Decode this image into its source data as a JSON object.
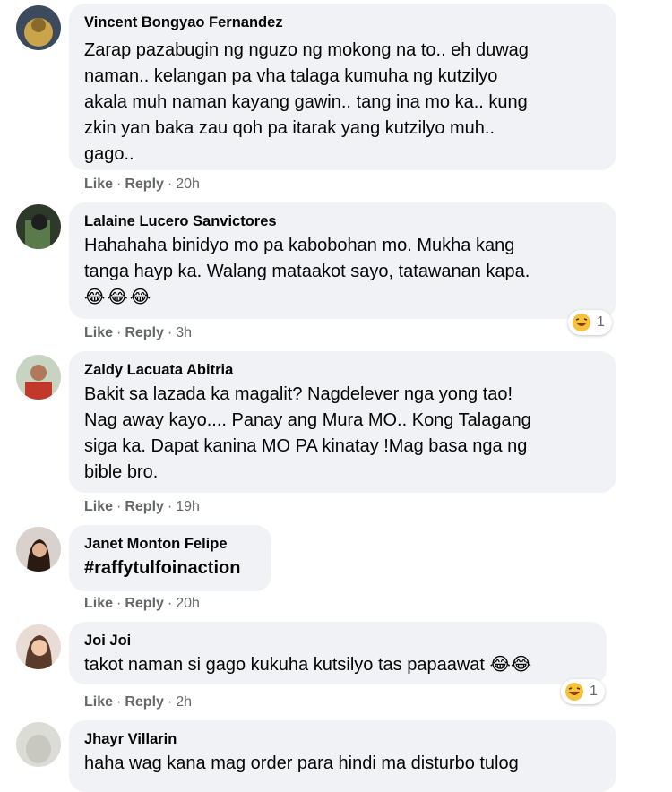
{
  "comments": [
    {
      "author": "Vincent Bongyao Fernandez",
      "lines": [
        "Zarap pazabugin ng nguzo ng mokong na to.. eh duwag",
        "naman.. kelangan pa vha talaga kumuha ng kutzilyo",
        "akala muh naman kayang gawin.. tang ina mo ka.. kung",
        "zkin yan baka zau qoh pa itarak yang kutzilyo muh..",
        "gago.."
      ],
      "like": "Like",
      "reply": "Reply",
      "time": "20h"
    },
    {
      "author": "Lalaine Lucero Sanvictores",
      "lines": [
        "Hahahaha binidyo mo pa kabobohan mo. Mukha kang",
        "tanga hayp ka. Walang mataakot sayo, tatawanan kapa."
      ],
      "emojis": "😂😂😂",
      "like": "Like",
      "reply": "Reply",
      "time": "3h",
      "reaction_icon": "laughing-face-icon",
      "reaction_count": "1"
    },
    {
      "author": "Zaldy Lacuata Abitria",
      "lines": [
        "Bakit sa lazada ka magalit? Nagdelever nga yong tao!",
        "Nag away kayo.... Panay ang Mura MO.. Kong Talagang",
        "siga ka. Dapat kanina MO PA kinatay !Mag basa nga ng",
        "bible bro."
      ],
      "like": "Like",
      "reply": "Reply",
      "time": "19h"
    },
    {
      "author": "Janet Monton Felipe",
      "lines": [
        "#raffytulfoinaction"
      ],
      "like": "Like",
      "reply": "Reply",
      "time": "20h"
    },
    {
      "author": "Joi Joi",
      "lines": [
        "takot naman si gago kukuha kutsilyo tas papaawat"
      ],
      "emojis": "😂😂",
      "like": "Like",
      "reply": "Reply",
      "time": "2h",
      "reaction_icon": "laughing-face-icon",
      "reaction_count": "1"
    },
    {
      "author": "Jhayr Villarin",
      "lines": [
        "haha wag kana mag order para hindi ma disturbo tulog"
      ]
    }
  ],
  "colors": {
    "bubble": "#f0f2f5",
    "meta": "#65676b",
    "text": "#050505",
    "emoji": "#f7c23b"
  }
}
